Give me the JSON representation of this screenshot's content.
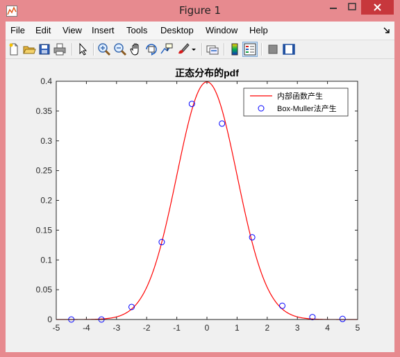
{
  "window": {
    "title": "Figure 1",
    "colors": {
      "frame": "#e78a8f",
      "close": "#c7373c",
      "plot_bg": "#ffffff",
      "figure_bg": "#f0f0f0"
    }
  },
  "menu": {
    "items": [
      "File",
      "Edit",
      "View",
      "Insert",
      "Tools",
      "Desktop",
      "Window",
      "Help"
    ]
  },
  "toolbar": {
    "icons": [
      "new-figure-icon",
      "open-file-icon",
      "save-icon",
      "print-icon",
      "edit-plot-arrow-icon",
      "zoom-in-icon",
      "zoom-out-icon",
      "pan-hand-icon",
      "rotate-3d-icon",
      "data-cursor-icon",
      "brush-icon",
      "brush-dropdown-icon",
      "link-plot-icon",
      "insert-colorbar-icon",
      "insert-legend-icon",
      "hide-plot-tools-icon",
      "show-plot-tools-icon"
    ]
  },
  "chart_data": {
    "type": "line",
    "title": "正态分布的pdf",
    "xlabel": "",
    "ylabel": "",
    "xlim": [
      -5,
      5
    ],
    "ylim": [
      0,
      0.4
    ],
    "xticks": [
      "-5",
      "-4",
      "-3",
      "-2",
      "-1",
      "0",
      "1",
      "2",
      "3",
      "4",
      "5"
    ],
    "yticks": [
      "0",
      "0.05",
      "0.1",
      "0.15",
      "0.2",
      "0.25",
      "0.3",
      "0.35",
      "0.4"
    ],
    "grid": false,
    "legend_position": "top-right",
    "series": [
      {
        "name": "内部函数产生",
        "style": "line",
        "color": "#ff0000",
        "function": "normal-pdf",
        "mean": 0,
        "sd": 1
      },
      {
        "name": "Box-Muller法产生",
        "style": "marker-circle",
        "color": "#0000ff",
        "x": [
          -4.5,
          -3.5,
          -2.5,
          -1.5,
          -0.5,
          0.5,
          1.5,
          2.5,
          3.5,
          4.5
        ],
        "y": [
          0.0,
          0.0,
          0.021,
          0.13,
          0.362,
          0.329,
          0.138,
          0.023,
          0.004,
          0.001
        ]
      }
    ]
  }
}
